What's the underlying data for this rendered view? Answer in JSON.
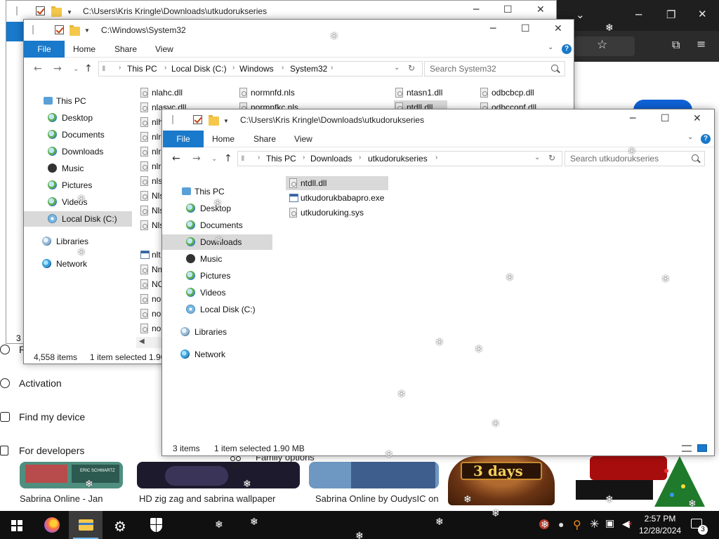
{
  "bg_window": {
    "title": "C:\\Users\\Kris Kringle\\Downloads\\utkudorukseries"
  },
  "sys32_window": {
    "title": "C:\\Windows\\System32",
    "ribbon": {
      "file": "File",
      "home": "Home",
      "share": "Share",
      "view": "View"
    },
    "address": [
      "This PC",
      "Local Disk (C:)",
      "Windows",
      "System32"
    ],
    "search_placeholder": "Search System32",
    "nav": [
      "This PC",
      "Desktop",
      "Documents",
      "Downloads",
      "Music",
      "Pictures",
      "Videos",
      "Local Disk (C:)",
      "Libraries",
      "Network"
    ],
    "files_col1": [
      "nlahc.dll",
      "nlasvc.dll",
      "nlh",
      "nlr",
      "nlr",
      "nlr",
      "nls",
      "Nls",
      "Nls",
      "Nls",
      "nlt",
      "Nm",
      "NO",
      "no",
      "no",
      "no"
    ],
    "files_col2": [
      "normnfd.nls",
      "normnfkc.nls"
    ],
    "files_col3": [
      "ntasn1.dll",
      "ntdll.dll"
    ],
    "files_col4": [
      "odbcbcp.dll",
      "odbcconf.dll"
    ],
    "status": {
      "count": "4,558 items",
      "selected": "1 item selected  1.90"
    },
    "bg_status": "3 i"
  },
  "dl_window": {
    "title": "C:\\Users\\Kris Kringle\\Downloads\\utkudorukseries",
    "ribbon": {
      "file": "File",
      "home": "Home",
      "share": "Share",
      "view": "View"
    },
    "address": [
      "This PC",
      "Downloads",
      "utkudorukseries"
    ],
    "search_placeholder": "Search utkudorukseries",
    "nav": [
      "This PC",
      "Desktop",
      "Documents",
      "Downloads",
      "Music",
      "Pictures",
      "Videos",
      "Local Disk (C:)",
      "Libraries",
      "Network"
    ],
    "files": [
      "ntdll.dll",
      "utkudorukbabapro.exe",
      "utkudoruking.sys"
    ],
    "status": {
      "count": "3 items",
      "selected": "1 item selected  1.90 MB"
    }
  },
  "settings": {
    "items": [
      "Activation",
      "Find my device",
      "For developers"
    ],
    "partial_r": "R",
    "partial_u": "U"
  },
  "strip": {
    "captions": [
      "Sabrina Online - Jan",
      "HD zig zag and sabrina wallpaper",
      "Sabrina Online by OudysIC on"
    ],
    "family": "Family options",
    "countdown": "3 days",
    "card_text": "ERIC SCHWARTZ"
  },
  "taskbar": {
    "time": "2:57 PM",
    "date": "12/28/2024",
    "notif_count": "3"
  },
  "colors": {
    "accent": "#1979ca",
    "selection": "#cce8ff",
    "taskbar": "#101010"
  }
}
